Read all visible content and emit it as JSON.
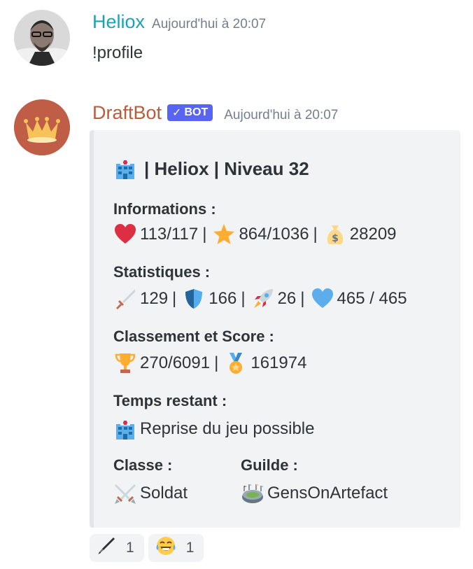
{
  "messages": [
    {
      "username": "Heliox",
      "timestamp": "Aujourd'hui à 20:07",
      "content": "!profile",
      "name_color": "#1aa3b8"
    },
    {
      "username": "DraftBot",
      "bot_label": "BOT",
      "timestamp": "Aujourd'hui à 20:07",
      "name_color": "#b85c3e"
    }
  ],
  "embed": {
    "title": "| Heliox | Niveau 32",
    "title_icon": "hospital-icon",
    "fields": {
      "informations": {
        "name": "Informations :",
        "health": "113/117",
        "experience": "864/1036",
        "money": "28209"
      },
      "statistiques": {
        "name": "Statistiques :",
        "attack": "129",
        "defense": "166",
        "speed": "26",
        "fight_health": "465 / 465"
      },
      "classement": {
        "name": "Classement et Score :",
        "rank": "270/6091",
        "score": "161974"
      },
      "temps": {
        "name": "Temps restant :",
        "value": "Reprise du jeu possible"
      },
      "classe": {
        "name": "Classe :",
        "value": "Soldat"
      },
      "guilde": {
        "name": "Guilde :",
        "value": "GensOnArtefact"
      }
    }
  },
  "reactions": [
    {
      "icon": "pen-icon",
      "count": "1"
    },
    {
      "icon": "laughing-tears-icon",
      "count": "1"
    }
  ]
}
